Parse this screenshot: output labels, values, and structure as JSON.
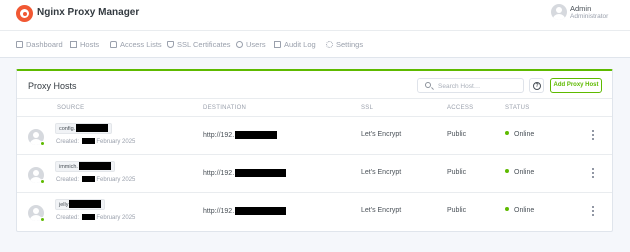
{
  "header": {
    "app_title": "Nginx Proxy Manager",
    "user_name": "Admin",
    "user_role": "Administrator"
  },
  "nav": [
    {
      "label": "Dashboard",
      "icon": "home-icon"
    },
    {
      "label": "Hosts",
      "icon": "server-icon"
    },
    {
      "label": "Access Lists",
      "icon": "lock-icon"
    },
    {
      "label": "SSL Certificates",
      "icon": "shield-icon"
    },
    {
      "label": "Users",
      "icon": "users-icon"
    },
    {
      "label": "Audit Log",
      "icon": "book-icon"
    },
    {
      "label": "Settings",
      "icon": "gear-icon"
    }
  ],
  "card": {
    "title": "Proxy Hosts",
    "search_placeholder": "Search Host…",
    "help_label": "?",
    "add_label": "Add Proxy Host",
    "accent_color": "#5eba00"
  },
  "table": {
    "columns": [
      "SOURCE",
      "DESTINATION",
      "SSL",
      "ACCESS",
      "STATUS"
    ],
    "rows": [
      {
        "source": "config.",
        "created_prefix": "Created:",
        "created_suffix": "February 2025",
        "destination": "http://192.",
        "ssl": "Let's Encrypt",
        "access": "Public",
        "status": "Online"
      },
      {
        "source": "immich.",
        "created_prefix": "Created:",
        "created_suffix": "February 2025",
        "destination": "http://192.",
        "ssl": "Let's Encrypt",
        "access": "Public",
        "status": "Online"
      },
      {
        "source": "jelly",
        "created_prefix": "Created:",
        "created_suffix": "February 2025",
        "destination": "http://192.",
        "ssl": "Let's Encrypt",
        "access": "Public",
        "status": "Online"
      }
    ]
  }
}
